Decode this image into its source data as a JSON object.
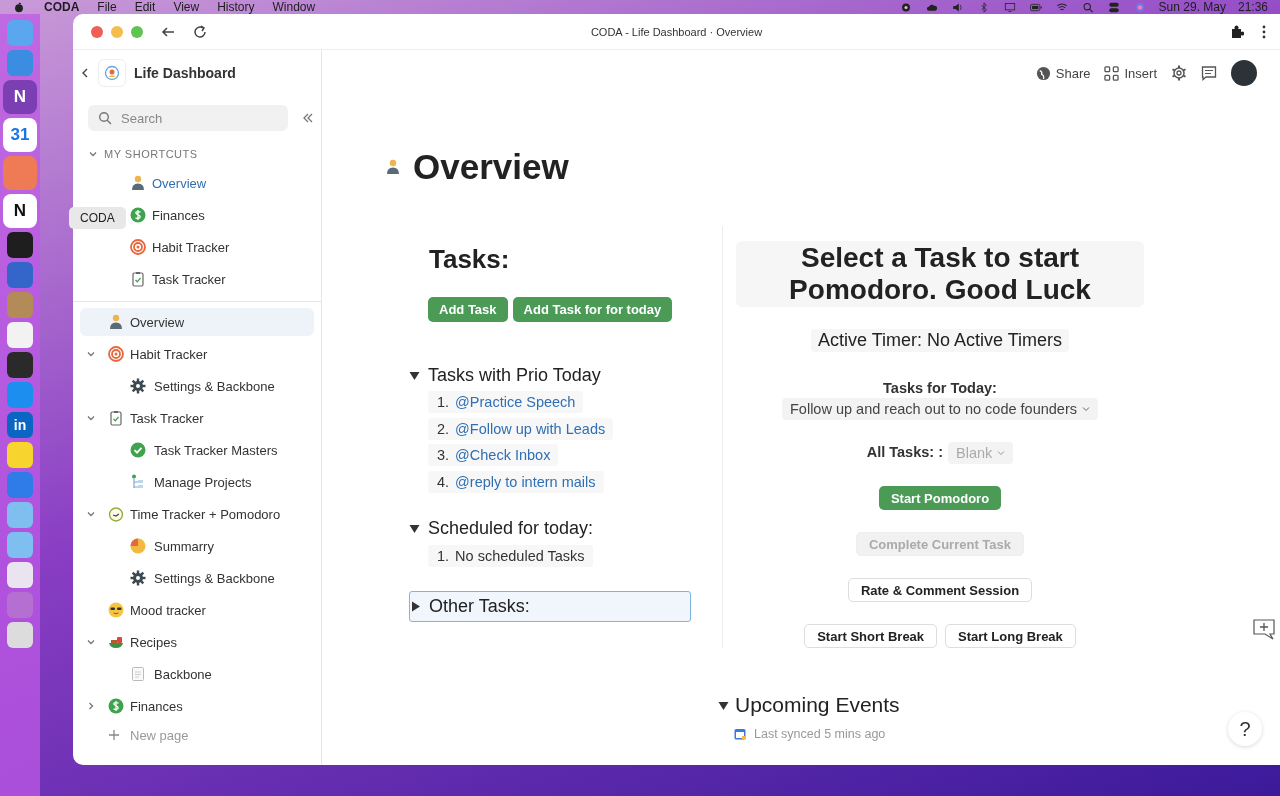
{
  "menu_bar": {
    "app": "CODA",
    "menus": [
      "File",
      "Edit",
      "View",
      "History",
      "Window"
    ],
    "date": "Sun 29. May",
    "time": "21:36"
  },
  "dock": {
    "tooltip": "CODA",
    "apps": [
      {
        "kind": "finder"
      },
      {
        "kind": "safari"
      },
      {
        "kind": "onenote",
        "glyph": "N"
      },
      {
        "kind": "calendar",
        "glyph": "31"
      },
      {
        "kind": "coda"
      },
      {
        "kind": "notion",
        "glyph": "N"
      },
      {
        "kind": "figma"
      },
      {
        "kind": "bitwarden"
      },
      {
        "kind": "contacts"
      },
      {
        "kind": "chrome"
      },
      {
        "kind": "quicktime"
      },
      {
        "kind": "appstore"
      },
      {
        "kind": "linkedin",
        "glyph": "in"
      },
      {
        "kind": "miro"
      },
      {
        "kind": "jira"
      },
      {
        "kind": "folder"
      },
      {
        "kind": "folder"
      },
      {
        "kind": "preview"
      },
      {
        "kind": "wallpaper"
      },
      {
        "kind": "trash"
      }
    ]
  },
  "window": {
    "title": "CODA - Life Dashboard · Overview"
  },
  "sidebar": {
    "doc_title": "Life Dashboard",
    "search": {
      "placeholder": "Search"
    },
    "shortcuts": {
      "title": "MY SHORTCUTS",
      "expanded": true,
      "items": [
        {
          "label": "Overview",
          "kind": "person",
          "selected": true
        },
        {
          "label": "Finances",
          "kind": "dollar",
          "selected": false
        },
        {
          "label": "Habit Tracker",
          "kind": "target",
          "selected": false
        },
        {
          "label": "Task Tracker",
          "kind": "clipboard",
          "selected": false
        }
      ]
    },
    "pages": [
      {
        "label": "Overview",
        "kind": "person",
        "selected": true
      },
      {
        "label": "Habit Tracker",
        "kind": "target",
        "selected": false,
        "expanded": true,
        "children": [
          {
            "label": "Settings & Backbone",
            "kind": "gear",
            "selected": false
          }
        ]
      },
      {
        "label": "Task Tracker",
        "kind": "clipboard",
        "selected": false,
        "expanded": true,
        "children": [
          {
            "label": "Task Tracker Masters",
            "kind": "check",
            "selected": false
          },
          {
            "label": "Manage Projects",
            "kind": "tree",
            "selected": false
          }
        ]
      },
      {
        "label": "Time Tracker + Pomodoro",
        "kind": "clock",
        "selected": false,
        "expanded": true,
        "children": [
          {
            "label": "Summarry",
            "kind": "pie",
            "selected": false
          },
          {
            "label": "Settings & Backbone",
            "kind": "gear",
            "selected": false
          }
        ]
      },
      {
        "label": "Mood tracker",
        "kind": "sunglasses",
        "selected": false
      },
      {
        "label": "Recipes",
        "kind": "bowl",
        "selected": false,
        "expanded": true,
        "children": [
          {
            "label": "Backbone",
            "kind": "doc",
            "selected": false
          }
        ]
      },
      {
        "label": "Finances",
        "kind": "dollar",
        "selected": false,
        "expanded": false
      }
    ],
    "new_page": "New page"
  },
  "toolbar": {
    "share": "Share",
    "insert": "Insert"
  },
  "page": {
    "title": "Overview",
    "tasks": {
      "heading": "Tasks:",
      "buttons": [
        "Add Task",
        "Add Task for for today"
      ],
      "sections": [
        {
          "title": "Tasks with Prio Today",
          "expanded": true,
          "focused": false,
          "items": [
            {
              "number": "1.",
              "text": "@Practice Speech",
              "kind": "link"
            },
            {
              "number": "2.",
              "text": "@Follow up with Leads",
              "kind": "link"
            },
            {
              "number": "3.",
              "text": "@Check Inbox",
              "kind": "link"
            },
            {
              "number": "4.",
              "text": "@reply to intern mails",
              "kind": "link"
            }
          ]
        },
        {
          "title": "Scheduled for today:",
          "expanded": true,
          "focused": false,
          "items": [
            {
              "number": "1.",
              "text": "No scheduled Tasks",
              "kind": "text"
            }
          ]
        },
        {
          "title": "Other Tasks:",
          "expanded": false,
          "focused": true
        }
      ]
    },
    "pomodoro": {
      "heading": "Select a Task to start Pomodoro. Good Luck",
      "active_timer": "Active Timer: No Active Timers",
      "tasks_for_today": {
        "label": "Tasks for Today:",
        "value": "Follow up and reach out to no code founders"
      },
      "all_tasks": {
        "label": "All Tasks: :",
        "placeholder": "Blank"
      },
      "button_rows": [
        [
          {
            "label": "Start Pomodoro",
            "kind": "primary",
            "disabled": false
          }
        ],
        [
          {
            "label": "Complete Current Task",
            "kind": "outline",
            "disabled": true
          }
        ],
        [
          {
            "label": "Rate & Comment Session",
            "kind": "outline",
            "disabled": false
          }
        ],
        [
          {
            "label": "Start Short Break",
            "kind": "outline",
            "disabled": false
          },
          {
            "label": "Start Long Break",
            "kind": "outline",
            "disabled": false
          }
        ]
      ]
    },
    "upcoming": {
      "title": "Upcoming Events",
      "expanded": true,
      "sync_text": "Last synced 5 mins ago"
    }
  },
  "help": "?"
}
